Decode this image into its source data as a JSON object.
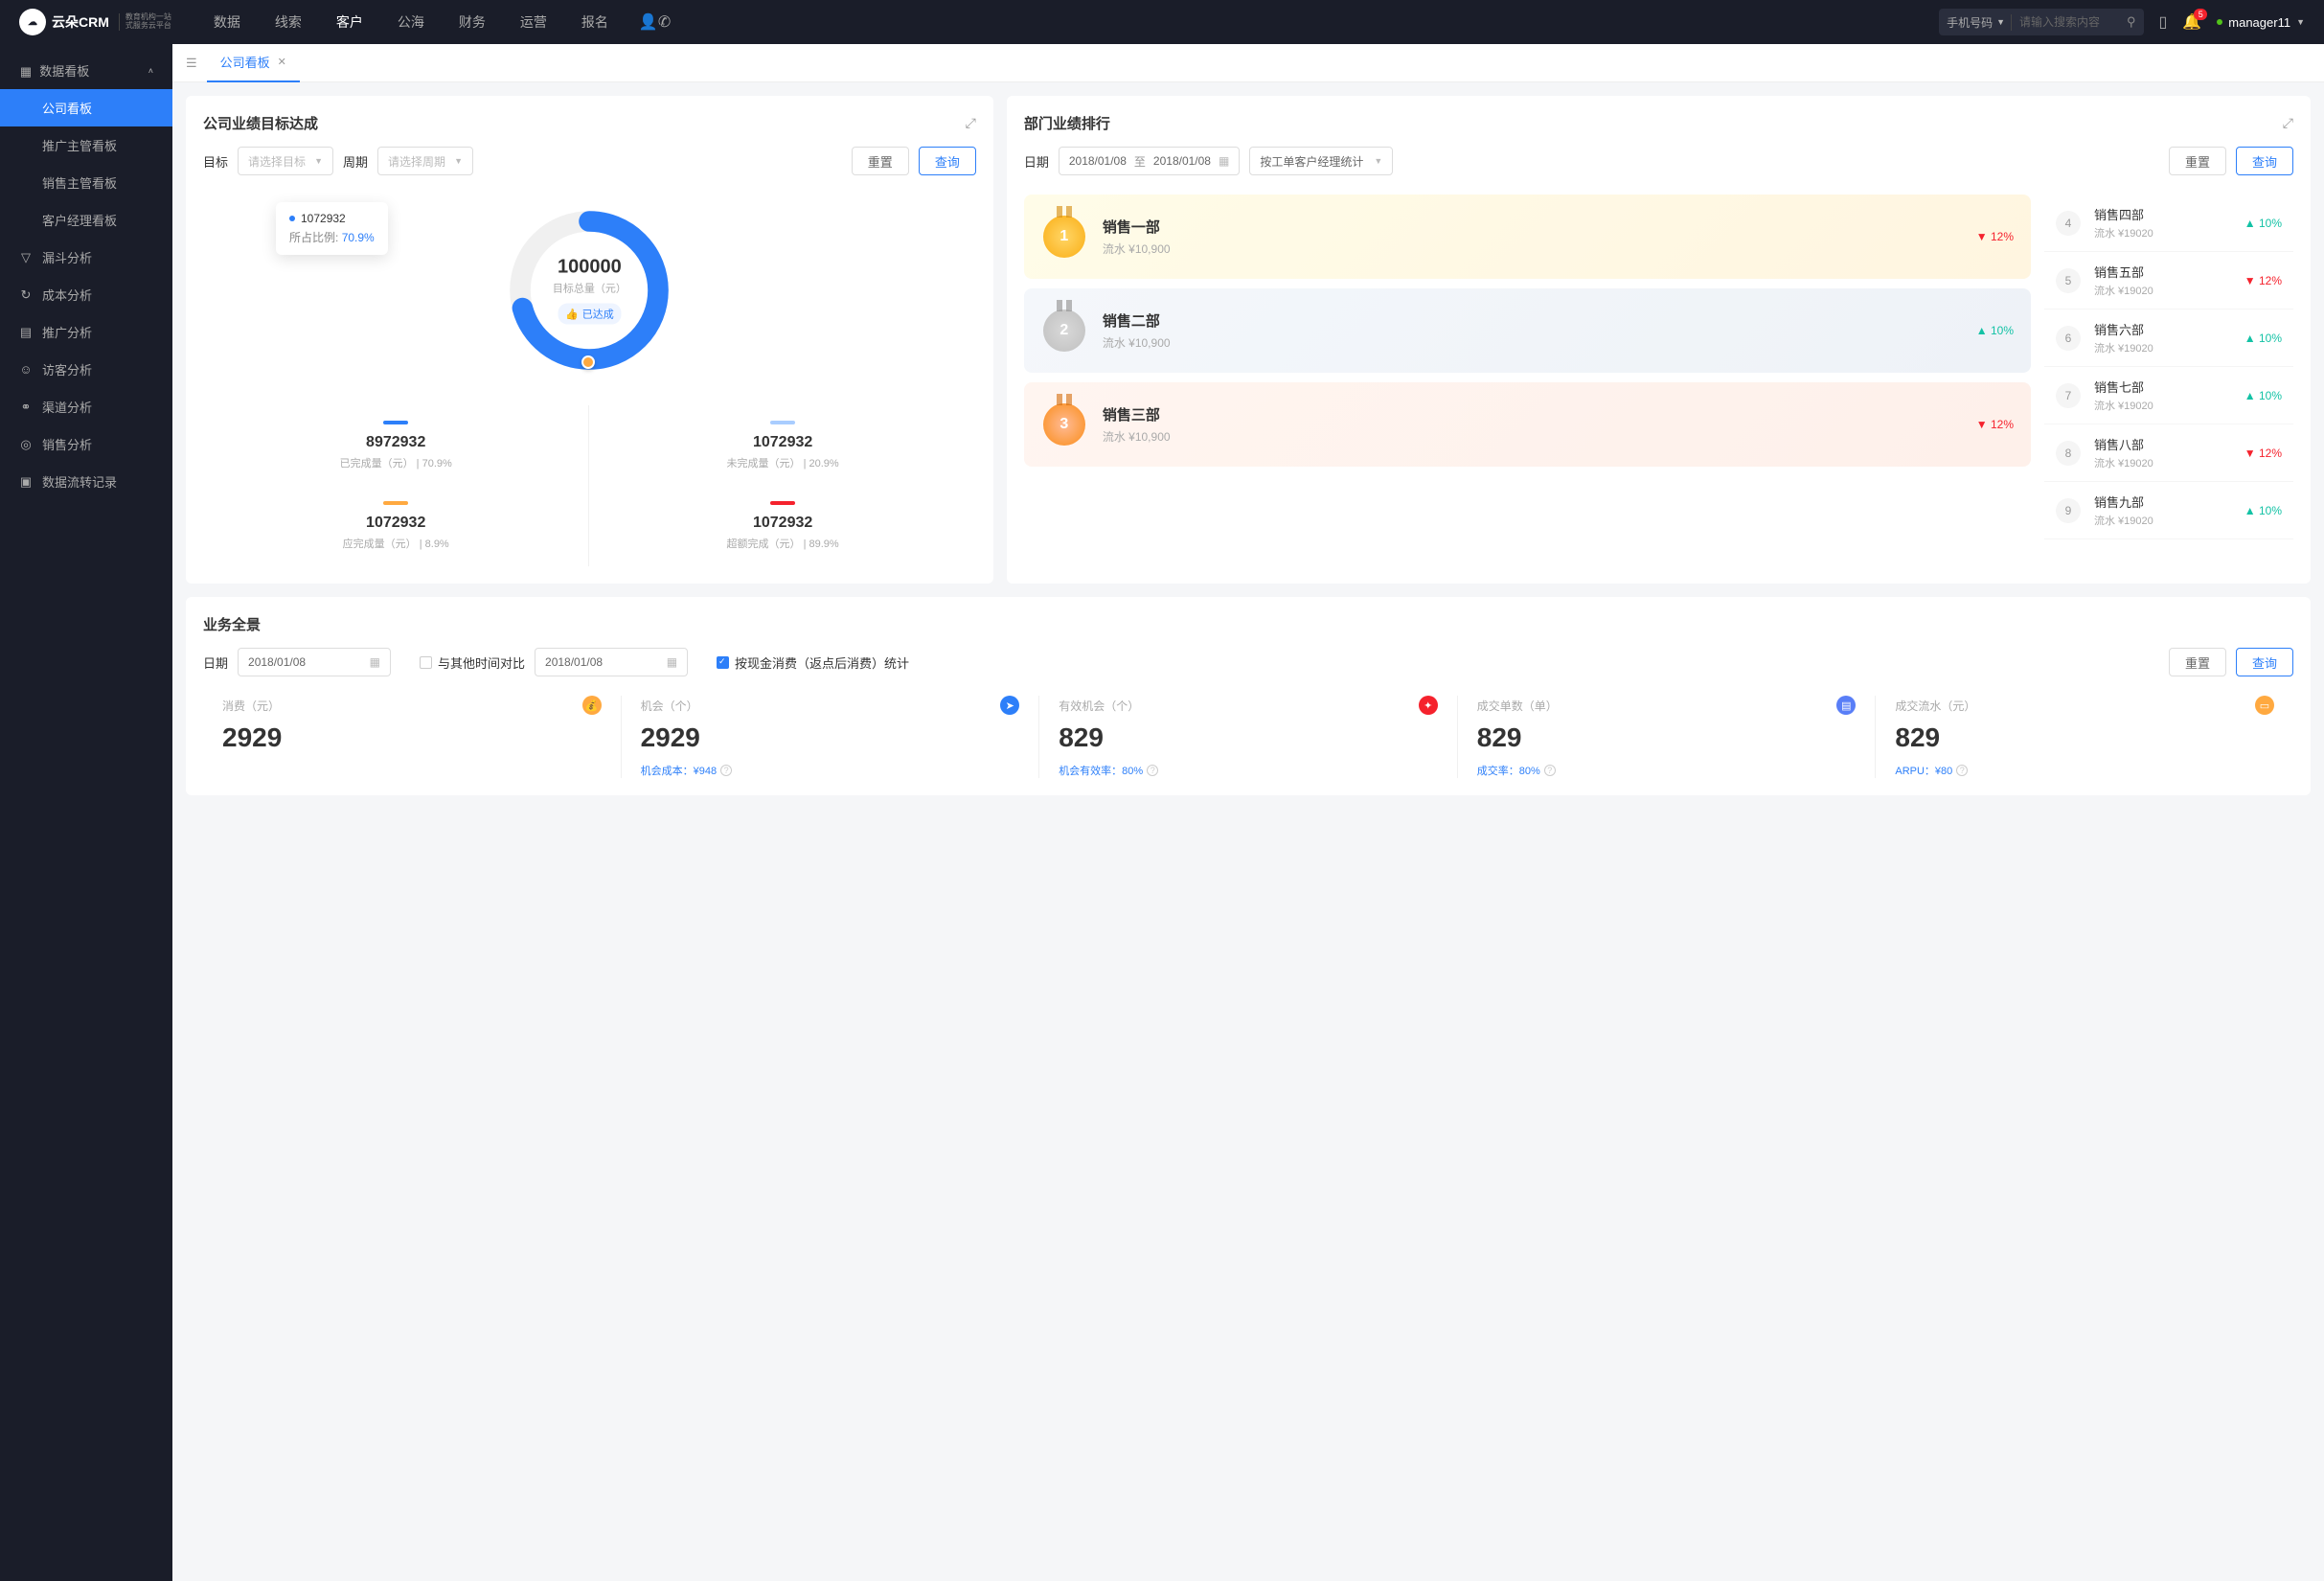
{
  "brand": {
    "name": "云朵CRM",
    "sub1": "教育机构一站",
    "sub2": "式服务云平台"
  },
  "topnav": {
    "items": [
      "数据",
      "线索",
      "客户",
      "公海",
      "财务",
      "运营",
      "报名"
    ],
    "active_index": 2,
    "search_type": "手机号码",
    "search_placeholder": "请输入搜索内容",
    "badge": "5",
    "user": "manager11"
  },
  "sidebar": {
    "group1": {
      "label": "数据看板"
    },
    "subs": [
      "公司看板",
      "推广主管看板",
      "销售主管看板",
      "客户经理看板"
    ],
    "active_sub": 0,
    "items": [
      {
        "icon": "▽",
        "label": "漏斗分析"
      },
      {
        "icon": "↻",
        "label": "成本分析"
      },
      {
        "icon": "▤",
        "label": "推广分析"
      },
      {
        "icon": "☺",
        "label": "访客分析"
      },
      {
        "icon": "⚭",
        "label": "渠道分析"
      },
      {
        "icon": "◎",
        "label": "销售分析"
      },
      {
        "icon": "▣",
        "label": "数据流转记录"
      }
    ]
  },
  "tab": {
    "label": "公司看板"
  },
  "target_card": {
    "title": "公司业绩目标达成",
    "target_label": "目标",
    "target_ph": "请选择目标",
    "period_label": "周期",
    "period_ph": "请选择周期",
    "reset": "重置",
    "query": "查询",
    "tooltip_value": "1072932",
    "tooltip_ratio_label": "所占比例:",
    "tooltip_ratio": "70.9%",
    "center_value": "100000",
    "center_label": "目标总量（元）",
    "center_badge": "已达成",
    "stats": [
      {
        "color": "#2d7ff9",
        "num": "8972932",
        "desc": "已完成量（元） | 70.9%"
      },
      {
        "color": "#a9cdff",
        "num": "1072932",
        "desc": "未完成量（元） | 20.9%"
      },
      {
        "color": "#ffa940",
        "num": "1072932",
        "desc": "应完成量（元） | 8.9%"
      },
      {
        "color": "#f5222d",
        "num": "1072932",
        "desc": "超额完成（元） | 89.9%"
      }
    ]
  },
  "rank_card": {
    "title": "部门业绩排行",
    "date_label": "日期",
    "date_from": "2018/01/08",
    "date_to": "2018/01/08",
    "date_sep": "至",
    "group_by": "按工单客户经理统计",
    "reset": "重置",
    "query": "查询",
    "top3": [
      {
        "cls": "gold",
        "num": "1",
        "name": "销售一部",
        "sub": "流水 ¥10,900",
        "dir": "down",
        "pct": "12%"
      },
      {
        "cls": "silver",
        "num": "2",
        "name": "销售二部",
        "sub": "流水 ¥10,900",
        "dir": "up",
        "pct": "10%"
      },
      {
        "cls": "bronze",
        "num": "3",
        "name": "销售三部",
        "sub": "流水 ¥10,900",
        "dir": "down",
        "pct": "12%"
      }
    ],
    "rest": [
      {
        "r": "4",
        "name": "销售四部",
        "sub": "流水 ¥19020",
        "dir": "up",
        "pct": "10%"
      },
      {
        "r": "5",
        "name": "销售五部",
        "sub": "流水 ¥19020",
        "dir": "down",
        "pct": "12%"
      },
      {
        "r": "6",
        "name": "销售六部",
        "sub": "流水 ¥19020",
        "dir": "up",
        "pct": "10%"
      },
      {
        "r": "7",
        "name": "销售七部",
        "sub": "流水 ¥19020",
        "dir": "up",
        "pct": "10%"
      },
      {
        "r": "8",
        "name": "销售八部",
        "sub": "流水 ¥19020",
        "dir": "down",
        "pct": "12%"
      },
      {
        "r": "9",
        "name": "销售九部",
        "sub": "流水 ¥19020",
        "dir": "up",
        "pct": "10%"
      }
    ]
  },
  "overview": {
    "title": "业务全景",
    "date_label": "日期",
    "date1": "2018/01/08",
    "compare_label": "与其他时间对比",
    "date2": "2018/01/08",
    "checkbox_label": "按现金消费（返点后消费）统计",
    "reset": "重置",
    "query": "查询",
    "cells": [
      {
        "label": "消费（元）",
        "icon_bg": "#ffa940",
        "icon": "💰",
        "value": "2929",
        "footer": ""
      },
      {
        "label": "机会（个）",
        "icon_bg": "#2d7ff9",
        "icon": "➤",
        "value": "2929",
        "footer": "机会成本：¥948"
      },
      {
        "label": "有效机会（个）",
        "icon_bg": "#f5222d",
        "icon": "✦",
        "value": "829",
        "footer": "机会有效率：80%"
      },
      {
        "label": "成交单数（单）",
        "icon_bg": "#597ef7",
        "icon": "▤",
        "value": "829",
        "footer": "成交率：80%"
      },
      {
        "label": "成交流水（元）",
        "icon_bg": "#ffa940",
        "icon": "▭",
        "value": "829",
        "footer": "ARPU：¥80"
      }
    ]
  },
  "chart_data": {
    "type": "pie",
    "title": "目标总量（元）",
    "total": 100000,
    "series": [
      {
        "name": "已完成量",
        "value": 8972932,
        "pct": 70.9,
        "color": "#2d7ff9"
      },
      {
        "name": "未完成量",
        "value": 1072932,
        "pct": 20.9,
        "color": "#a9cdff"
      },
      {
        "name": "应完成量",
        "value": 1072932,
        "pct": 8.9,
        "color": "#ffa940"
      },
      {
        "name": "超额完成",
        "value": 1072932,
        "pct": 89.9,
        "color": "#f5222d"
      }
    ]
  }
}
